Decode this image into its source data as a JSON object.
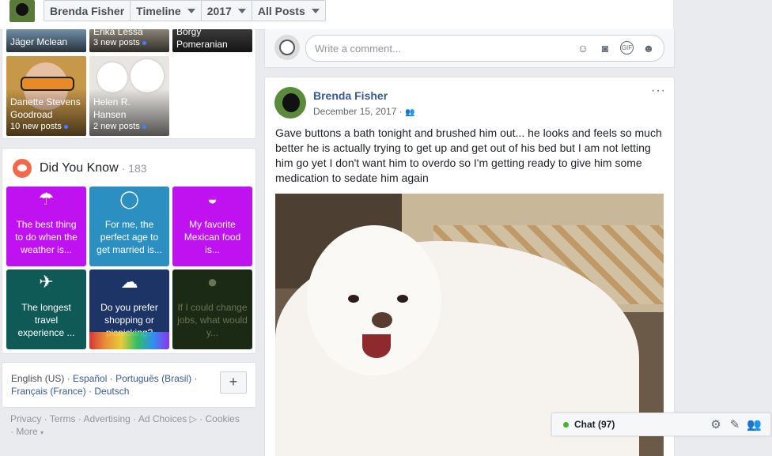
{
  "topbar": {
    "crumbs": [
      "Brenda Fisher",
      "Timeline",
      "2017",
      "All Posts"
    ]
  },
  "friends": [
    {
      "name": "Jäger Mclean",
      "new": ""
    },
    {
      "name": "Erika Lessa",
      "new": "3 new posts"
    },
    {
      "name": "Borgy Pomeranian",
      "new": ""
    },
    {
      "name": "Danette Stevens Goodroad",
      "new": "10 new posts"
    },
    {
      "name": "Helen R. Hansen",
      "new": "2 new posts"
    }
  ],
  "did_you_know": {
    "title": "Did You Know",
    "count": "· 183",
    "cards": [
      {
        "text": "The best thing to do when the weather is...",
        "color": "#c012f0",
        "icon": "umbrella-icon",
        "glyph": "☂"
      },
      {
        "text": "For me, the perfect age to get married is...",
        "color": "#2c8fc1",
        "icon": "ring-icon",
        "glyph": "◯"
      },
      {
        "text": "My favorite Mexican food is...",
        "color": "#c012f0",
        "icon": "bowl-icon",
        "glyph": "◒"
      },
      {
        "text": "The longest travel experience ...",
        "color": "#0f5a57",
        "icon": "airplane-icon",
        "glyph": "✈"
      },
      {
        "text": "Do you prefer shopping or picnicking?",
        "color": "#1d3566",
        "icon": "thought-bubble-icon",
        "glyph": "☁"
      },
      {
        "text": "If I could change jobs, what would y...",
        "color": "#1b2a14",
        "icon": "question-icon",
        "glyph": "●"
      }
    ]
  },
  "languages": {
    "current": "English (US)",
    "others": [
      "Español",
      "Português (Brasil)",
      "Français (France)",
      "Deutsch"
    ],
    "plus": "+"
  },
  "footer": [
    "Privacy",
    "Terms",
    "Advertising",
    "Ad Choices",
    "Cookies",
    "More"
  ],
  "comment_box": {
    "placeholder": "Write a comment...",
    "icons": [
      "emoji-icon",
      "camera-icon",
      "gif-icon",
      "sticker-icon"
    ]
  },
  "post": {
    "author": "Brenda Fisher",
    "date": "December 15, 2017",
    "audience_icon": "friends-icon",
    "text": "Gave buttons a bath tonight and brushed him out... he looks and feels so much better he is actually trying to get up and get out of his bed but I am not letting him go yet I don't want him to overdo so I'm getting ready to give him some medication to sedate him again",
    "more": "···"
  },
  "chat": {
    "label": "Chat (97)",
    "status_color": "#42b72a",
    "icons": [
      "gear-icon",
      "compose-icon",
      "contacts-icon"
    ]
  }
}
